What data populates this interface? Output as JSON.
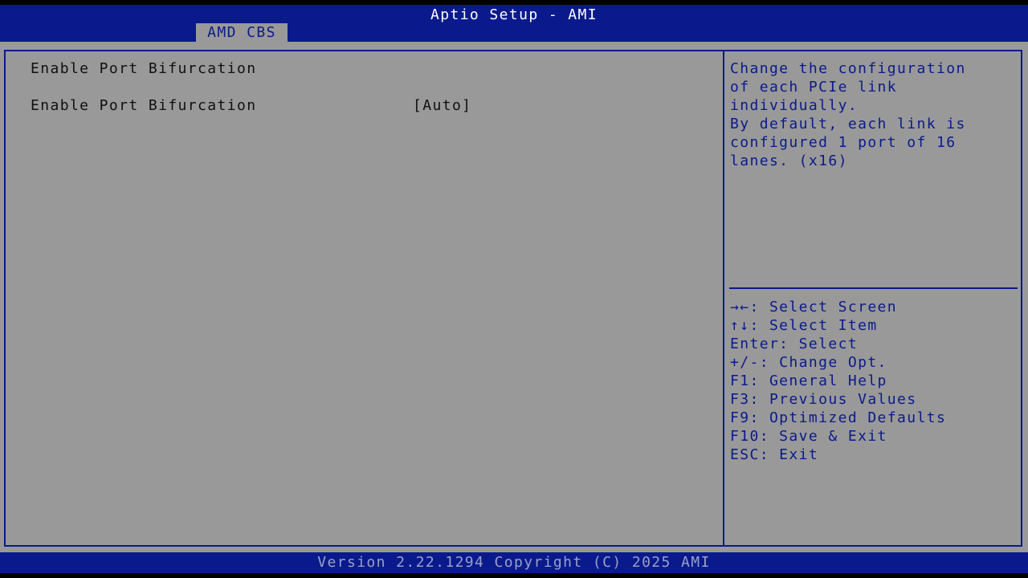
{
  "header": {
    "title": "Aptio Setup - AMI",
    "tab": "AMD CBS"
  },
  "main": {
    "section_title": "Enable Port Bifurcation",
    "option": {
      "label": "Enable Port Bifurcation",
      "value": "[Auto]"
    }
  },
  "help": {
    "lines": [
      "Change the configuration",
      "of each PCIe link",
      "individually.",
      "By default, each link is",
      "configured 1 port of 16",
      "lanes. (x16)"
    ]
  },
  "keys": [
    "→←: Select Screen",
    "↑↓: Select Item",
    "Enter: Select",
    "+/-: Change Opt.",
    "F1: General Help",
    "F3: Previous Values",
    "F9: Optimized Defaults",
    "F10: Save & Exit",
    "ESC: Exit"
  ],
  "footer": {
    "text": "Version 2.22.1294 Copyright (C) 2025 AMI"
  },
  "colors": {
    "bios_blue": "#0a1a8c",
    "panel_gray": "#999999",
    "footer_text": "#9aa0c8"
  }
}
